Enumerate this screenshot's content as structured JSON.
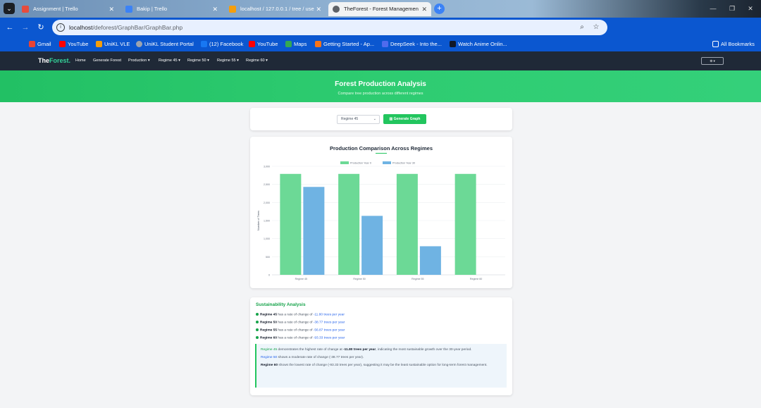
{
  "browser": {
    "tabs": [
      {
        "title": "Assignment | Trello",
        "fav_color": "#e74c3c"
      },
      {
        "title": "Bakip | Trello",
        "fav_color": "#3b82f6"
      },
      {
        "title": "localhost / 127.0.0.1 / tree / use",
        "fav_color": "#f59e0b"
      },
      {
        "title": "TheForest - Forest Managemen",
        "fav_color": "#5f6368"
      }
    ],
    "url_host": "localhost",
    "url_path": "/deforest/GraphBar/GraphBar.php",
    "bookmarks": [
      {
        "label": "Gmail",
        "color": "#ea4335"
      },
      {
        "label": "YouTube",
        "color": "#ff0000"
      },
      {
        "label": "UniKL VLE",
        "color": "#f59e0b"
      },
      {
        "label": "UniKL Student Portal",
        "color": "#9ca3af"
      },
      {
        "label": "(12) Facebook",
        "color": "#1877f2"
      },
      {
        "label": "YouTube",
        "color": "#ff0000"
      },
      {
        "label": "Maps",
        "color": "#34a853"
      },
      {
        "label": "Getting Started - Ap...",
        "color": "#f97316"
      },
      {
        "label": "DeepSeek - Into the...",
        "color": "#4f6bed"
      },
      {
        "label": "Watch Anime Onlin...",
        "color": "#111827"
      }
    ],
    "all_bookmarks": "All Bookmarks"
  },
  "site": {
    "brand_a": "The",
    "brand_b": "Forest.",
    "nav": [
      "Home",
      "Generate Forest",
      "Production ▾",
      "Regime 45 ▾",
      "Regime 50 ▾",
      "Regime 55 ▾",
      "Regime 60 ▾"
    ],
    "user_btn": "⚙ ▾"
  },
  "hero": {
    "title": "Forest Production Analysis",
    "subtitle": "Compare tree production across different regimes"
  },
  "controls": {
    "selected": "Regime 45",
    "button": "Generate Graph"
  },
  "chart_data": {
    "type": "bar",
    "title": "Production Comparison Across Regimes",
    "xlabel": "",
    "ylabel": "Number of Trees",
    "categories": [
      "Regime 45",
      "Regime 50",
      "Regime 55",
      "Regime 60"
    ],
    "series": [
      {
        "name": "Production Year 0",
        "color": "#6cd996",
        "values": [
          2790,
          2790,
          2790,
          2790
        ]
      },
      {
        "name": "Production Year 30",
        "color": "#6fb3e3",
        "values": [
          2430,
          1630,
          790,
          0
        ]
      }
    ],
    "yticks": [
      "0",
      "500",
      "1,000",
      "1,500",
      "2,000",
      "2,500",
      "3,000"
    ],
    "ylim": [
      0,
      3000
    ],
    "grid": true,
    "legend": "top-center"
  },
  "sustainability": {
    "title": "Sustainability Analysis",
    "items": [
      {
        "regime": "Regime 45",
        "mid": " has a rate of change of ",
        "rate": "-11.80 trees per year"
      },
      {
        "regime": "Regime 50",
        "mid": " has a rate of change of ",
        "rate": "-38.77 trees per year"
      },
      {
        "regime": "Regime 55",
        "mid": " has a rate of change of ",
        "rate": "-56.87 trees per year"
      },
      {
        "regime": "Regime 60",
        "mid": " has a rate of change of ",
        "rate": "-93.33 trees per year"
      }
    ],
    "summary": [
      {
        "a": "Regime 45",
        "b": " demonstrates the highest rate of change at ",
        "c": "-11.80 trees per year",
        "d": ", indicating the most sustainable growth over the 30-year period."
      },
      {
        "a": "Regime 50",
        "b": " shows a moderate rate of change (",
        "c": "-38.77 trees per year",
        "d": ")."
      },
      {
        "a": "Regime 60",
        "b": " shows the lowest rate of change (",
        "c": "-93.33 trees per year",
        "d": "), suggesting it may be the least sustainable option for long-term forest management."
      }
    ]
  }
}
